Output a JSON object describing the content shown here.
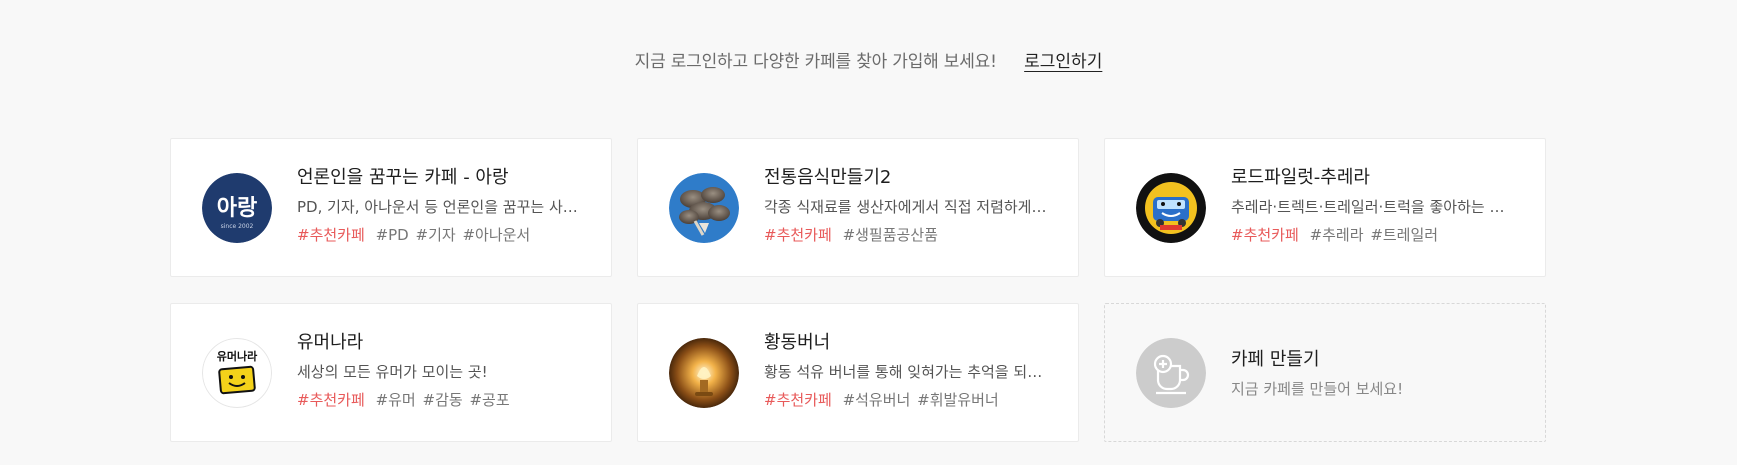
{
  "login_bar": {
    "message": "지금 로그인하고 다양한 카페를 찾아 가입해 보세요!",
    "login_link": "로그인하기"
  },
  "cafes": [
    {
      "name": "언론인을 꿈꾸는 카페 - 아랑",
      "description": "PD, 기자, 아나운서 등 언론인을 꿈꾸는 사람들의 모임",
      "recommend_tag": "#추천카페",
      "tags": [
        "#PD",
        "#기자",
        "#아나운서"
      ],
      "logo_text": "아랑",
      "logo_sub": "since 2002",
      "logo_color": "#1f3b6e"
    },
    {
      "name": "전통음식만들기2",
      "description": "각종 식재료를 생산자에게서 직접 저렴하게 구입하는 곳",
      "recommend_tag": "#추천카페",
      "tags": [
        "#생필품공산품"
      ],
      "logo_color": "#3a7fc1"
    },
    {
      "name": "로드파일럿-추레라",
      "description": "추레라·트렉트·트레일러·트럭을 좋아하는 사람들",
      "recommend_tag": "#추천카페",
      "tags": [
        "#추레라",
        "#트레일러"
      ],
      "logo_color": "#f2c11f"
    },
    {
      "name": "유머나라",
      "description": "세상의 모든 유머가 모이는 곳!",
      "recommend_tag": "#추천카페",
      "tags": [
        "#유머",
        "#감동",
        "#공포"
      ],
      "logo_text": "유머나라",
      "logo_color": "#f4d21a"
    },
    {
      "name": "황동버너",
      "description": "황동 석유 버너를 통해 잊혀가는 추억을 되새기는 곳",
      "recommend_tag": "#추천카페",
      "tags": [
        "#석유버너",
        "#휘발유버너"
      ],
      "logo_color": "#6b3e12"
    }
  ],
  "create_cafe": {
    "title": "카페 만들기",
    "subtitle": "지금 카페를 만들어 보세요!",
    "icon": "add-cafe-cup-icon",
    "icon_bg": "#cccccc"
  },
  "colors": {
    "recommend_tag": "#e85a5a",
    "page_bg": "#f8f8f8"
  }
}
